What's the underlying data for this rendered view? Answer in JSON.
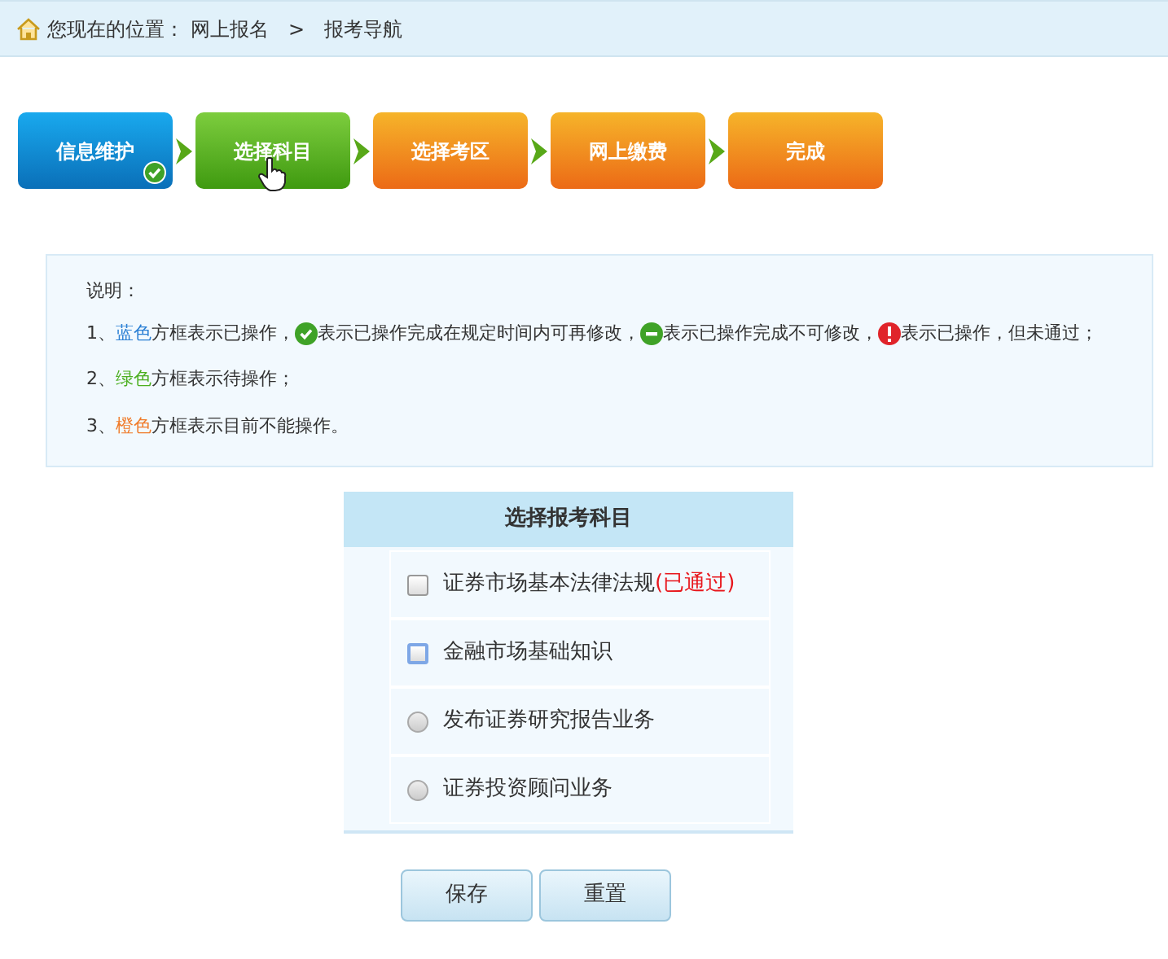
{
  "breadcrumb": {
    "label": "您现在的位置：",
    "items": [
      "网上报名",
      "报考导航"
    ],
    "separator": ">"
  },
  "steps": [
    {
      "label": "信息维护",
      "kind": "blue",
      "done": true,
      "pointer": false
    },
    {
      "label": "选择科目",
      "kind": "green",
      "done": false,
      "pointer": true
    },
    {
      "label": "选择考区",
      "kind": "orange",
      "done": false,
      "pointer": false
    },
    {
      "label": "网上缴费",
      "kind": "orange",
      "done": false,
      "pointer": false
    },
    {
      "label": "完成",
      "kind": "orange",
      "done": false,
      "pointer": false
    }
  ],
  "legend": {
    "title": "说明：",
    "lines": [
      [
        {
          "kind": "text",
          "text": "1、"
        },
        {
          "kind": "colored",
          "text": "蓝色",
          "color": "#2a7fd4"
        },
        {
          "kind": "text",
          "text": "方框表示已操作，"
        },
        {
          "kind": "check"
        },
        {
          "kind": "text",
          "text": "表示已操作完成在规定时间内可再修改，"
        },
        {
          "kind": "minus"
        },
        {
          "kind": "text",
          "text": "表示已操作完成不可修改，"
        },
        {
          "kind": "alert"
        },
        {
          "kind": "text",
          "text": "表示已操作，但未通过；"
        }
      ],
      [
        {
          "kind": "text",
          "text": "2、"
        },
        {
          "kind": "colored",
          "text": "绿色",
          "color": "#4caf20"
        },
        {
          "kind": "text",
          "text": "方框表示待操作；"
        }
      ],
      [
        {
          "kind": "text",
          "text": "3、"
        },
        {
          "kind": "colored",
          "text": "橙色",
          "color": "#f07b2a"
        },
        {
          "kind": "text",
          "text": "方框表示目前不能操作。"
        }
      ]
    ]
  },
  "subjects": {
    "title": "选择报考科目",
    "items": [
      {
        "kind": "checkbox",
        "label": "证券市场基本法律法规",
        "note": "(已通过)",
        "checked": false,
        "focused": false
      },
      {
        "kind": "checkbox",
        "label": "金融市场基础知识",
        "checked": false,
        "focused": true
      },
      {
        "kind": "radio",
        "label": "发布证券研究报告业务",
        "checked": false,
        "focused": false
      },
      {
        "kind": "radio",
        "label": "证券投资顾问业务",
        "checked": false,
        "focused": false
      }
    ]
  },
  "buttons": [
    "保存",
    "重置"
  ]
}
